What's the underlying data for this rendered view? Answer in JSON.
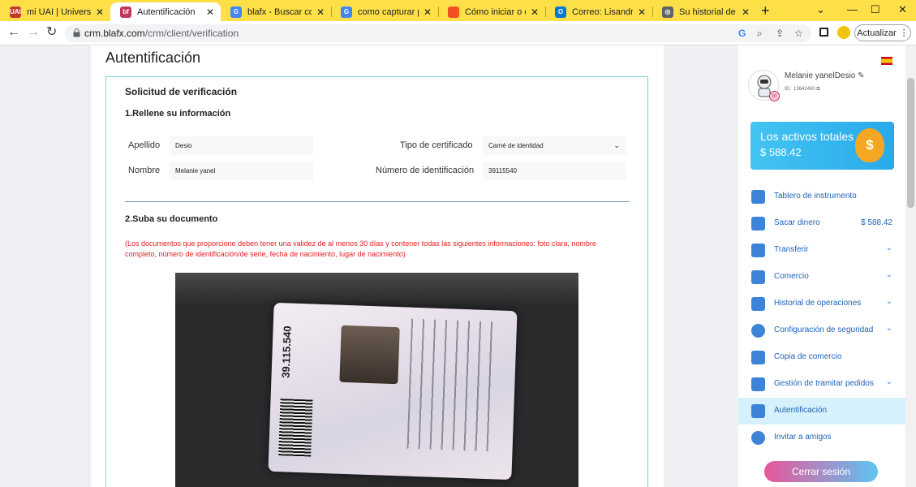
{
  "browser": {
    "tabs": [
      {
        "title": "mi UAI | Universidad A",
        "favicon": "uai-logo",
        "fav_text": "UAI",
        "fav_color": "#c0392b",
        "active": false
      },
      {
        "title": "Autentificación",
        "favicon": "blafx-logo",
        "fav_text": "bf",
        "fav_color": "#c0395e",
        "active": true
      },
      {
        "title": "blafx - Buscar con Go",
        "favicon": "google-icon",
        "fav_text": "G",
        "fav_color": "#4285f4",
        "active": false
      },
      {
        "title": "como capturar pantal",
        "favicon": "google-icon",
        "fav_text": "G",
        "fav_color": "#4285f4",
        "active": false
      },
      {
        "title": "Cómo iniciar o cerrar",
        "favicon": "microsoft-icon",
        "fav_text": "",
        "fav_color": "#f25022",
        "active": false
      },
      {
        "title": "Correo: Lisandro Farif",
        "favicon": "outlook-icon",
        "fav_text": "O",
        "fav_color": "#0078d4",
        "active": false
      },
      {
        "title": "Su historial de transfe",
        "favicon": "globe-icon",
        "fav_text": "◎",
        "fav_color": "#5f6368",
        "active": false
      }
    ],
    "new_tab_label": "+",
    "url_host": "crm.blafx.com",
    "url_path": "/crm/client/verification",
    "update_label": "Actualizar"
  },
  "page": {
    "title": "Autentificación",
    "card_title": "Solicitud de verificación",
    "section1_title": "1.Rellene su información",
    "fields": {
      "apellido_label": "Apellido",
      "apellido_value": "Desio",
      "nombre_label": "Nombre",
      "nombre_value": "Melanie yanel",
      "tipo_label": "Tipo de certificado",
      "tipo_value": "Carné de identidad",
      "numero_label": "Número de identificación",
      "numero_value": "39115540"
    },
    "section2_title": "2.Suba su documento",
    "notice": "(Los documentos que proporcione deben tener una validez de al menos 30 días y contener todas las siguientes informaciones: foto clara, nombre completo, número de identificación/de serie, fecha de nacimiento, lugar de nacimiento)",
    "document_number_on_card": "39.115.540"
  },
  "sidebar": {
    "user_name": "Melanie yanelDesio",
    "user_id_label": "ID:",
    "user_id": "13642430",
    "assets_title": "Los activos totales",
    "assets_value": "$ 588.42",
    "menu": [
      {
        "label": "Tablero de instrumento",
        "icon": "dashboard-icon",
        "value": "",
        "chevron": false,
        "active": false
      },
      {
        "label": "Sacar dinero",
        "icon": "wallet-icon",
        "value": "$ 588.42",
        "chevron": false,
        "active": false
      },
      {
        "label": "Transferir",
        "icon": "transfer-icon",
        "value": "",
        "chevron": true,
        "active": false
      },
      {
        "label": "Comercio",
        "icon": "monitor-icon",
        "value": "",
        "chevron": true,
        "active": false
      },
      {
        "label": "Historial de operaciones",
        "icon": "history-icon",
        "value": "",
        "chevron": true,
        "active": false
      },
      {
        "label": "Configuración de seguridad",
        "icon": "gear-icon",
        "value": "",
        "chevron": true,
        "active": false
      },
      {
        "label": "Copia de comercio",
        "icon": "copy-icon",
        "value": "",
        "chevron": false,
        "active": false
      },
      {
        "label": "Gestión de tramitar pedidos",
        "icon": "orders-icon",
        "value": "",
        "chevron": true,
        "active": false
      },
      {
        "label": "Autentificación",
        "icon": "id-card-icon",
        "value": "",
        "chevron": false,
        "active": true
      },
      {
        "label": "Invitar a amigos",
        "icon": "invite-icon",
        "value": "",
        "chevron": false,
        "active": false
      }
    ],
    "logout_label": "Cerrar sesión",
    "accent_color": "#3d83d8"
  }
}
